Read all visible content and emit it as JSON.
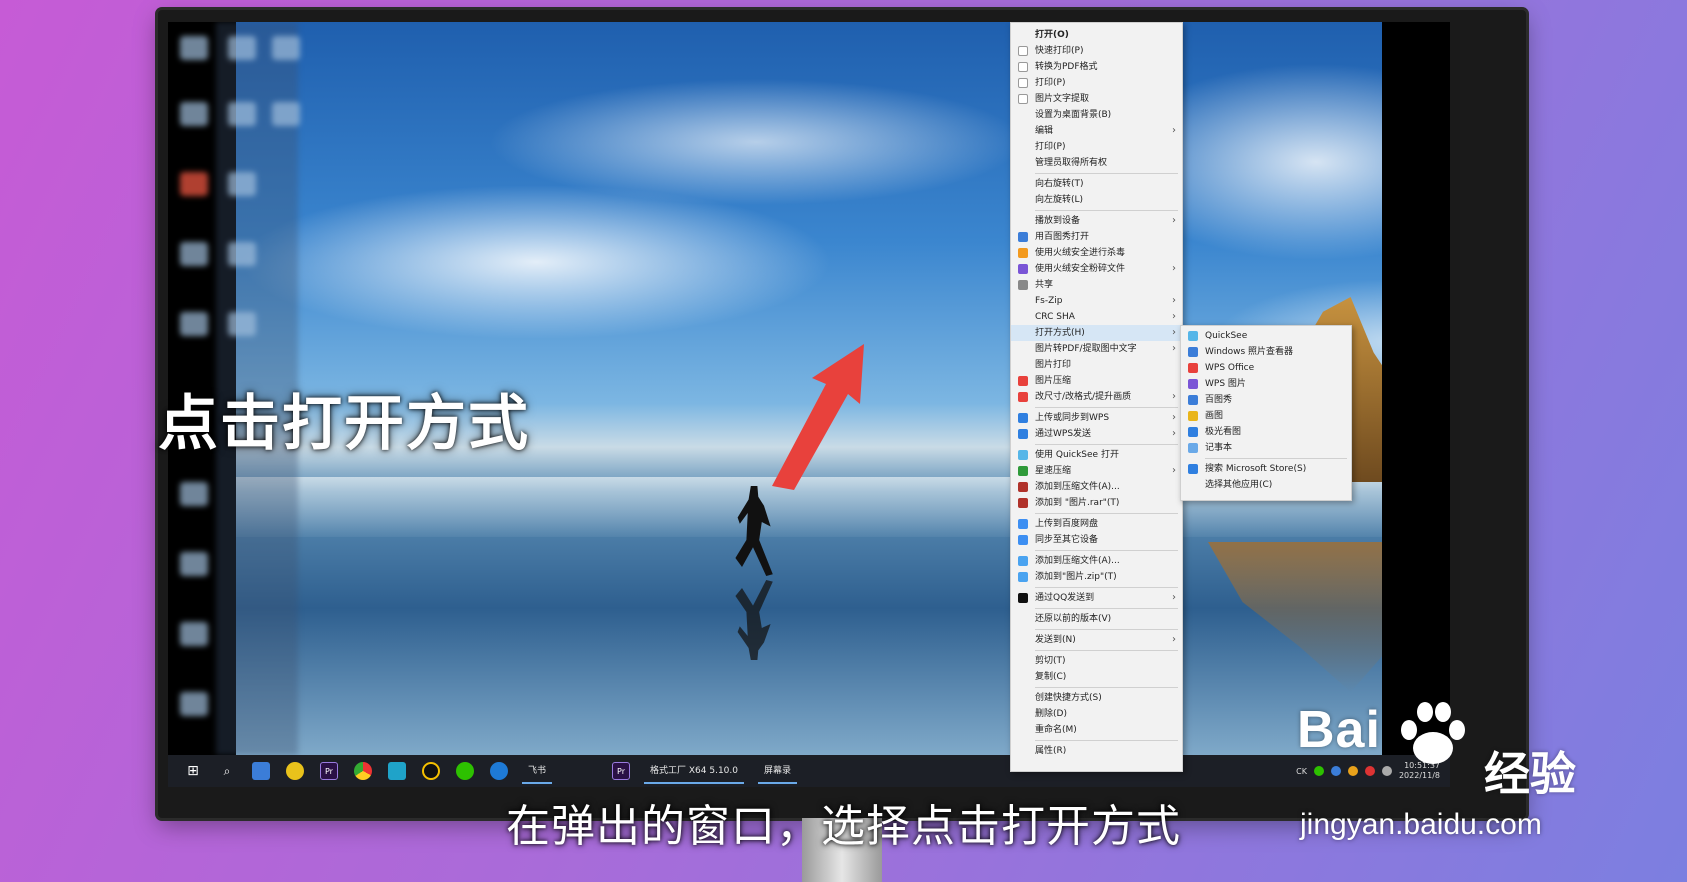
{
  "context_menu": {
    "items": [
      {
        "label": "打开(O)",
        "bold": true,
        "icon": ""
      },
      {
        "label": "快速打印(P)",
        "icon": "page-icon"
      },
      {
        "label": "转换为PDF格式",
        "icon": "page-icon"
      },
      {
        "label": "打印(P)",
        "icon": "page-icon"
      },
      {
        "label": "图片文字提取",
        "icon": "page-icon"
      },
      {
        "label": "设置为桌面背景(B)",
        "icon": ""
      },
      {
        "label": "编辑",
        "icon": "",
        "submenu": true
      },
      {
        "label": "打印(P)",
        "icon": ""
      },
      {
        "label": "管理员取得所有权",
        "icon": ""
      },
      {
        "sep": true
      },
      {
        "label": "向右旋转(T)",
        "icon": ""
      },
      {
        "label": "向左旋转(L)",
        "icon": ""
      },
      {
        "sep": true
      },
      {
        "label": "播放到设备",
        "icon": "",
        "submenu": true
      },
      {
        "label": "用百图秀打开",
        "icon": "image-icon"
      },
      {
        "label": "使用火绒安全进行杀毒",
        "icon": "flame-icon"
      },
      {
        "label": "使用火绒安全粉碎文件",
        "icon": "shred-icon",
        "submenu": true
      },
      {
        "label": "共享",
        "icon": "share-icon"
      },
      {
        "label": "Fs-Zip",
        "icon": "",
        "submenu": true
      },
      {
        "label": "CRC SHA",
        "icon": "",
        "submenu": true
      },
      {
        "label": "打开方式(H)",
        "icon": "",
        "submenu": true,
        "highlight": true
      },
      {
        "label": "图片转PDF/提取图中文字",
        "icon": "",
        "submenu": true
      },
      {
        "label": "图片打印",
        "icon": ""
      },
      {
        "label": "图片压缩",
        "icon": "wps-icon"
      },
      {
        "label": "改尺寸/改格式/提升画质",
        "icon": "wps-icon",
        "submenu": true
      },
      {
        "sep": true
      },
      {
        "label": "上传或同步到WPS",
        "icon": "cloud-icon",
        "submenu": true
      },
      {
        "label": "通过WPS发送",
        "icon": "send-icon",
        "submenu": true
      },
      {
        "sep": true
      },
      {
        "label": "使用 QuickSee 打开",
        "icon": "quicksee-icon"
      },
      {
        "label": "星速压缩",
        "icon": "zip-icon",
        "submenu": true
      },
      {
        "label": "添加到压缩文件(A)...",
        "icon": "rar-icon"
      },
      {
        "label": "添加到 \"图片.rar\"(T)",
        "icon": "rar-icon"
      },
      {
        "sep": true
      },
      {
        "label": "上传到百度网盘",
        "icon": "baidu-cloud-icon"
      },
      {
        "label": "同步至其它设备",
        "icon": "baidu-cloud-icon"
      },
      {
        "sep": true
      },
      {
        "label": "添加到压缩文件(A)...",
        "icon": "zip-blue-icon"
      },
      {
        "label": "添加到\"图片.zip\"(T)",
        "icon": "zip-blue-icon"
      },
      {
        "sep": true
      },
      {
        "label": "通过QQ发送到",
        "icon": "qq-icon",
        "submenu": true
      },
      {
        "sep": true
      },
      {
        "label": "还原以前的版本(V)",
        "icon": ""
      },
      {
        "sep": true
      },
      {
        "label": "发送到(N)",
        "icon": "",
        "submenu": true
      },
      {
        "sep": true
      },
      {
        "label": "剪切(T)",
        "icon": ""
      },
      {
        "label": "复制(C)",
        "icon": ""
      },
      {
        "sep": true
      },
      {
        "label": "创建快捷方式(S)",
        "icon": ""
      },
      {
        "label": "删除(D)",
        "icon": ""
      },
      {
        "label": "重命名(M)",
        "icon": ""
      },
      {
        "sep": true
      },
      {
        "label": "属性(R)",
        "icon": ""
      }
    ]
  },
  "open_with_submenu": {
    "items": [
      {
        "label": "QuickSee",
        "icon": "quicksee-icon"
      },
      {
        "label": "Windows 照片查看器",
        "icon": "photo-viewer-icon"
      },
      {
        "label": "WPS Office",
        "icon": "wps-icon"
      },
      {
        "label": "WPS 图片",
        "icon": "wps-image-icon"
      },
      {
        "label": "百图秀",
        "icon": "image-icon"
      },
      {
        "label": "画图",
        "icon": "paint-icon"
      },
      {
        "label": "极光看图",
        "icon": "aurora-icon"
      },
      {
        "label": "记事本",
        "icon": "notepad-icon"
      },
      {
        "sep": true
      },
      {
        "label": "搜索 Microsoft Store(S)",
        "icon": "store-icon"
      },
      {
        "label": "选择其他应用(C)",
        "icon": ""
      }
    ]
  },
  "taskbar": {
    "tasks": [
      {
        "label": "飞书"
      },
      {
        "label": "格式工厂 X64 5.10.0"
      },
      {
        "label": "屏幕录"
      }
    ],
    "tray": {
      "ime": "CK",
      "time": "10:51:37",
      "date": "2022/11/8"
    }
  },
  "overlay": {
    "left_caption": "点击打开方式",
    "subtitle": "在弹出的窗口，选择点击打开方式"
  },
  "watermark": {
    "brand": "Bai",
    "brand_cn": "经验",
    "url": "jingyan.baidu.com"
  },
  "colors": {
    "arrow": "#e8413c",
    "menu_highlight": "#d6e6f5",
    "taskbar": "#1c1f26"
  }
}
